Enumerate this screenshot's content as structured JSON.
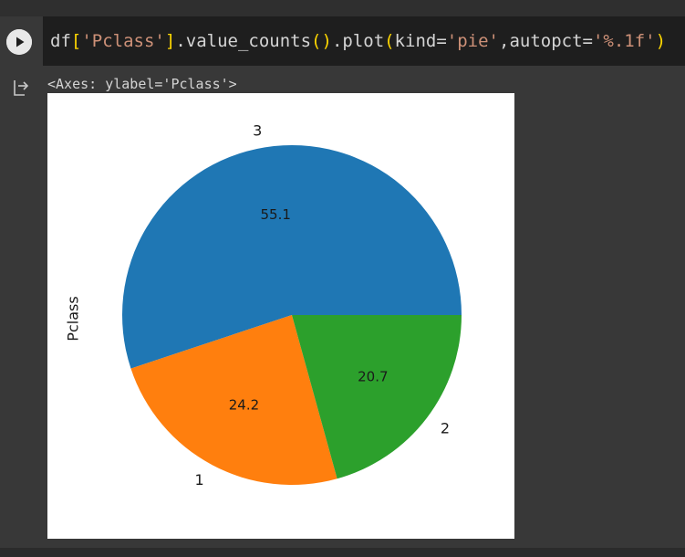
{
  "cell": {
    "code": {
      "p1": "df",
      "p2": "[",
      "p3": "'Pclass'",
      "p4": "]",
      "p5": ".value_counts",
      "p6": "(",
      "p7": ")",
      "p8": ".plot",
      "p9": "(",
      "p10": "kind=",
      "p11": "'pie'",
      "p12": ",autopct=",
      "p13": "'%.1f'",
      "p14": ")"
    },
    "output_text": "<Axes: ylabel='Pclass'>",
    "run_icon": "play-icon",
    "output_icon": "output-arrow-icon"
  },
  "chart_data": {
    "type": "pie",
    "categories": [
      "3",
      "1",
      "2"
    ],
    "values": [
      55.1,
      24.2,
      20.7
    ],
    "autopct_labels": [
      "55.1",
      "24.2",
      "20.7"
    ],
    "colors": [
      "#1f77b4",
      "#ff7f0e",
      "#2ca02c"
    ],
    "ylabel": "Pclass",
    "startangle": 0
  }
}
